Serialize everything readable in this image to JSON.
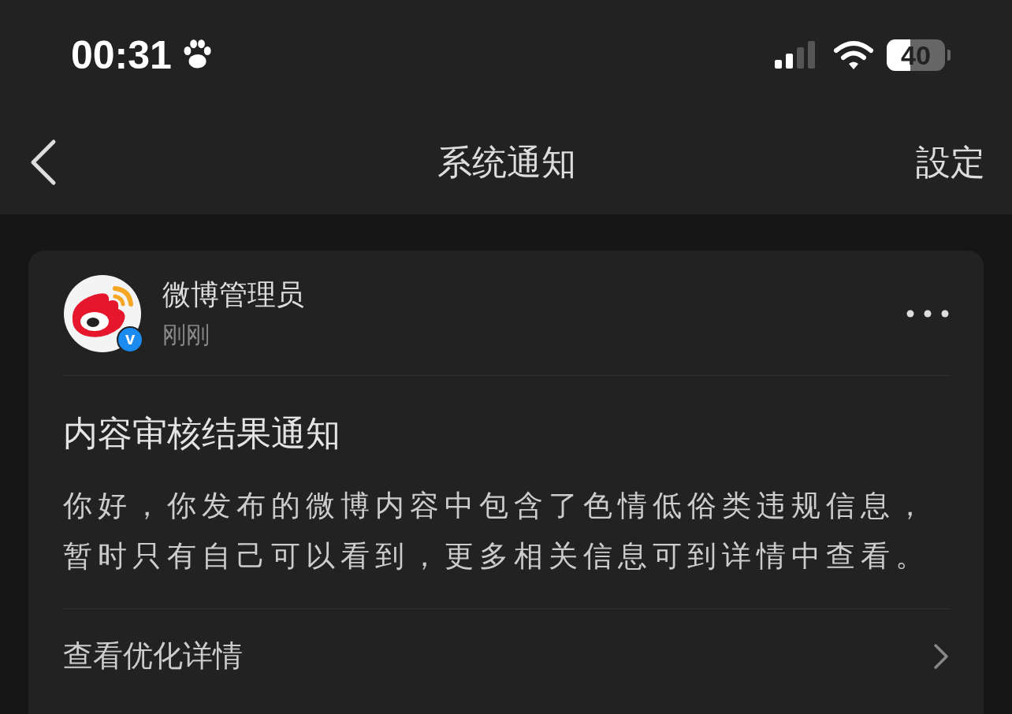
{
  "status_bar": {
    "time": "00:31",
    "battery": "40"
  },
  "nav": {
    "title": "系统通知",
    "action": "設定"
  },
  "notification": {
    "sender": "微博管理员",
    "time": "刚刚",
    "verified_badge": "v",
    "title": "内容审核结果通知",
    "body": "你好，你发布的微博内容中包含了色情低俗类违规信息，暂时只有自己可以看到，更多相关信息可到详情中查看。",
    "link": "查看优化详情"
  }
}
